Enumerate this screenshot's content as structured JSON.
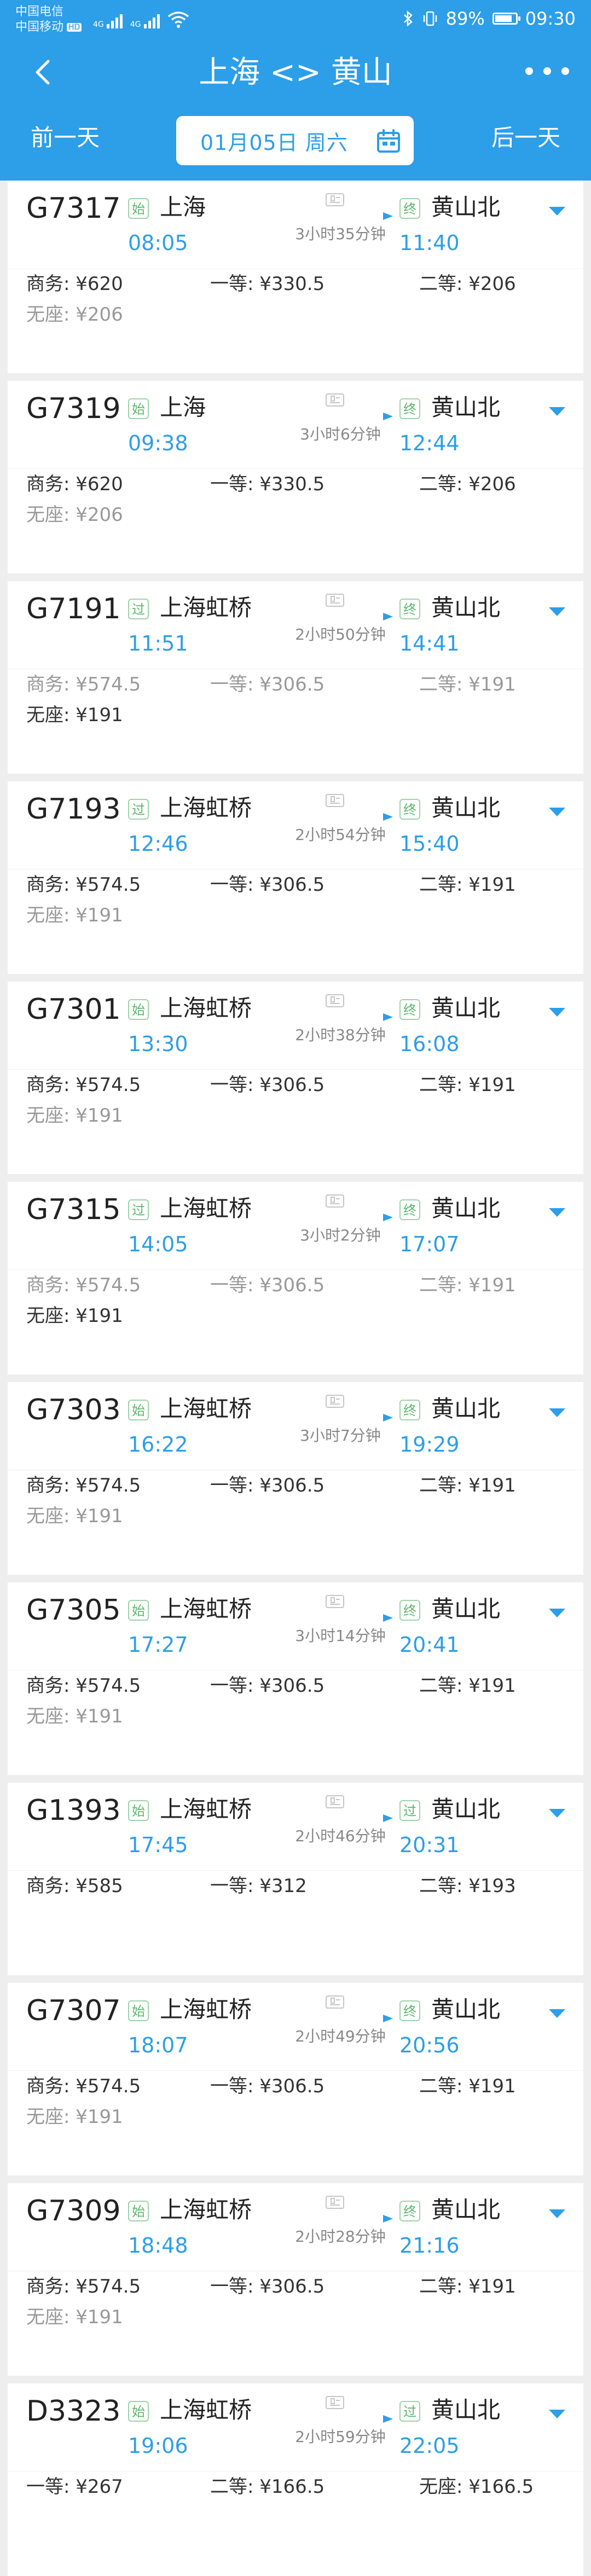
{
  "status": {
    "carrier1": "中国电信",
    "carrier2": "中国移动",
    "hd": "HD",
    "net1": "4G",
    "net2": "4G",
    "battery": "89%",
    "time": "09:30"
  },
  "nav": {
    "title": "上海 <> 黄山",
    "prev_day": "前一天",
    "date": "01月05日 周六",
    "next_day": "后一天"
  },
  "colors": {
    "primary": "#2d9ee8",
    "badge_green": "#5cb56c",
    "time_blue": "#2d9ee8",
    "muted": "#999999"
  },
  "trains": [
    {
      "no": "G7317",
      "from_tag": "始",
      "from": "上海",
      "dep": "08:05",
      "duration": "3小时35分钟",
      "to_tag": "终",
      "to": "黄山北",
      "arr": "11:40",
      "prices": [
        "商务: ¥620",
        "一等: ¥330.5",
        "二等: ¥206",
        "无座: ¥206"
      ],
      "muted": [
        false,
        false,
        false,
        true
      ]
    },
    {
      "no": "G7319",
      "from_tag": "始",
      "from": "上海",
      "dep": "09:38",
      "duration": "3小时6分钟",
      "to_tag": "终",
      "to": "黄山北",
      "arr": "12:44",
      "prices": [
        "商务: ¥620",
        "一等: ¥330.5",
        "二等: ¥206",
        "无座: ¥206"
      ],
      "muted": [
        false,
        false,
        false,
        true
      ]
    },
    {
      "no": "G7191",
      "from_tag": "过",
      "from": "上海虹桥",
      "dep": "11:51",
      "duration": "2小时50分钟",
      "to_tag": "终",
      "to": "黄山北",
      "arr": "14:41",
      "prices": [
        "商务: ¥574.5",
        "一等: ¥306.5",
        "二等: ¥191",
        "无座: ¥191"
      ],
      "muted": [
        true,
        true,
        true,
        false
      ]
    },
    {
      "no": "G7193",
      "from_tag": "过",
      "from": "上海虹桥",
      "dep": "12:46",
      "duration": "2小时54分钟",
      "to_tag": "终",
      "to": "黄山北",
      "arr": "15:40",
      "prices": [
        "商务: ¥574.5",
        "一等: ¥306.5",
        "二等: ¥191",
        "无座: ¥191"
      ],
      "muted": [
        false,
        false,
        false,
        true
      ]
    },
    {
      "no": "G7301",
      "from_tag": "始",
      "from": "上海虹桥",
      "dep": "13:30",
      "duration": "2小时38分钟",
      "to_tag": "终",
      "to": "黄山北",
      "arr": "16:08",
      "prices": [
        "商务: ¥574.5",
        "一等: ¥306.5",
        "二等: ¥191",
        "无座: ¥191"
      ],
      "muted": [
        false,
        false,
        false,
        true
      ]
    },
    {
      "no": "G7315",
      "from_tag": "过",
      "from": "上海虹桥",
      "dep": "14:05",
      "duration": "3小时2分钟",
      "to_tag": "终",
      "to": "黄山北",
      "arr": "17:07",
      "prices": [
        "商务: ¥574.5",
        "一等: ¥306.5",
        "二等: ¥191",
        "无座: ¥191"
      ],
      "muted": [
        true,
        true,
        true,
        false
      ]
    },
    {
      "no": "G7303",
      "from_tag": "始",
      "from": "上海虹桥",
      "dep": "16:22",
      "duration": "3小时7分钟",
      "to_tag": "终",
      "to": "黄山北",
      "arr": "19:29",
      "prices": [
        "商务: ¥574.5",
        "一等: ¥306.5",
        "二等: ¥191",
        "无座: ¥191"
      ],
      "muted": [
        false,
        false,
        false,
        true
      ]
    },
    {
      "no": "G7305",
      "from_tag": "始",
      "from": "上海虹桥",
      "dep": "17:27",
      "duration": "3小时14分钟",
      "to_tag": "终",
      "to": "黄山北",
      "arr": "20:41",
      "prices": [
        "商务: ¥574.5",
        "一等: ¥306.5",
        "二等: ¥191",
        "无座: ¥191"
      ],
      "muted": [
        false,
        false,
        false,
        true
      ]
    },
    {
      "no": "G1393",
      "from_tag": "始",
      "from": "上海虹桥",
      "dep": "17:45",
      "duration": "2小时46分钟",
      "to_tag": "过",
      "to": "黄山北",
      "arr": "20:31",
      "prices": [
        "商务: ¥585",
        "一等: ¥312",
        "二等: ¥193",
        ""
      ],
      "muted": [
        false,
        false,
        false,
        false
      ]
    },
    {
      "no": "G7307",
      "from_tag": "始",
      "from": "上海虹桥",
      "dep": "18:07",
      "duration": "2小时49分钟",
      "to_tag": "终",
      "to": "黄山北",
      "arr": "20:56",
      "prices": [
        "商务: ¥574.5",
        "一等: ¥306.5",
        "二等: ¥191",
        "无座: ¥191"
      ],
      "muted": [
        false,
        false,
        false,
        true
      ]
    },
    {
      "no": "G7309",
      "from_tag": "始",
      "from": "上海虹桥",
      "dep": "18:48",
      "duration": "2小时28分钟",
      "to_tag": "终",
      "to": "黄山北",
      "arr": "21:16",
      "prices": [
        "商务: ¥574.5",
        "一等: ¥306.5",
        "二等: ¥191",
        "无座: ¥191"
      ],
      "muted": [
        false,
        false,
        false,
        true
      ]
    },
    {
      "no": "D3323",
      "from_tag": "始",
      "from": "上海虹桥",
      "dep": "19:06",
      "duration": "2小时59分钟",
      "to_tag": "过",
      "to": "黄山北",
      "arr": "22:05",
      "prices": [
        "一等: ¥267",
        "二等: ¥166.5",
        "无座: ¥166.5",
        ""
      ],
      "muted": [
        false,
        false,
        false,
        false
      ]
    }
  ]
}
